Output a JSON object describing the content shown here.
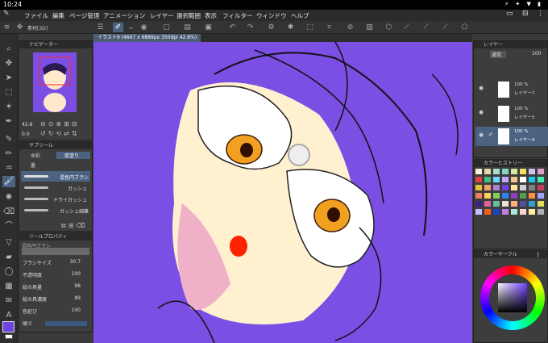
{
  "status": {
    "time": "10:24",
    "icons": "⚡ ✦ ▼ ▮"
  },
  "menu": [
    {
      "name": "menu-file",
      "label": "ファイル"
    },
    {
      "name": "menu-edit",
      "label": "編集"
    },
    {
      "name": "menu-page",
      "label": "ページ管理"
    },
    {
      "name": "menu-animation",
      "label": "アニメーション"
    },
    {
      "name": "menu-layer",
      "label": "レイヤー"
    },
    {
      "name": "menu-select",
      "label": "選択範囲"
    },
    {
      "name": "menu-view",
      "label": "表示"
    },
    {
      "name": "menu-filter",
      "label": "フィルター"
    },
    {
      "name": "menu-window",
      "label": "ウィンドウ"
    },
    {
      "name": "menu-help",
      "label": "ヘルプ"
    }
  ],
  "sozai_tab": "素材[3D]",
  "document_tab": "イラスト9 (4667 x 6889px 350dpi 42.8%)",
  "navigator": {
    "title": "ナビゲーター",
    "zoom": "42.8",
    "angle": "0.0"
  },
  "subtool": {
    "title": "サブツール",
    "tab1": "水彩",
    "tab2": "厚塗り",
    "tab3": "墨",
    "brushes": [
      "混色円ブラシ",
      "ガッシュ",
      "ドライガッシュ",
      "ガッシュ細筆"
    ]
  },
  "toolprop": {
    "title": "ツールプロパティ",
    "brush_name": "混色円ブラシ",
    "rows": [
      {
        "label": "ブラシサイズ",
        "value": "30.7"
      },
      {
        "label": "不透明度",
        "value": "100"
      },
      {
        "label": "絵の具量",
        "value": "98"
      },
      {
        "label": "絵の具濃度",
        "value": "89"
      },
      {
        "label": "色延び",
        "value": "100"
      },
      {
        "label": "硬さ",
        "value": ""
      }
    ]
  },
  "layer_panel": {
    "title": "レイヤー",
    "blend": "通常",
    "opacity": "100",
    "layers": [
      {
        "pct": "100 %",
        "mode": "通常",
        "name": "レイヤー7"
      },
      {
        "pct": "100 %",
        "mode": "通常",
        "name": "レイヤー5"
      },
      {
        "pct": "100 %",
        "mode": "通常",
        "name": "レイヤー4"
      }
    ]
  },
  "history_title": "カラーヒストリー",
  "wheel_title": "カラーサークル",
  "colors": {
    "canvas_bg": "#7B4EE4",
    "skin": "#FFF0D0",
    "mask": "#FFFFFF",
    "eye": "#F2A020",
    "mouth": "#FF2200",
    "history": [
      "#f5f0d8",
      "#e8d8a8",
      "#a8e0d0",
      "#80d8c0",
      "#d8e8a0",
      "#f0e060",
      "#d0c0f0",
      "#e0a0c8",
      "#e04040",
      "#40c080",
      "#70d8ff",
      "#c0a8ff",
      "#f4c890",
      "#ffffff",
      "#20c8f0",
      "#40e8b0",
      "#e8c040",
      "#f0a070",
      "#b080d8",
      "#7840e0",
      "#ffe8a0",
      "#d0d0d0",
      "#808080",
      "#c04060",
      "#f08060",
      "#ffd060",
      "#80d060",
      "#3080f0",
      "#9040c0",
      "#50a050",
      "#ff9040",
      "#a0a0ff",
      "#402080",
      "#e060a0",
      "#60c0a0",
      "#f0e0d0",
      "#ffb080",
      "#5050a0",
      "#30a0d0",
      "#e0e060",
      "#c0c0ff",
      "#f06020",
      "#2040c0",
      "#c080e0",
      "#a8e8d8",
      "#f8d8c8",
      "#fff0a0",
      "#b0b0b0"
    ]
  }
}
